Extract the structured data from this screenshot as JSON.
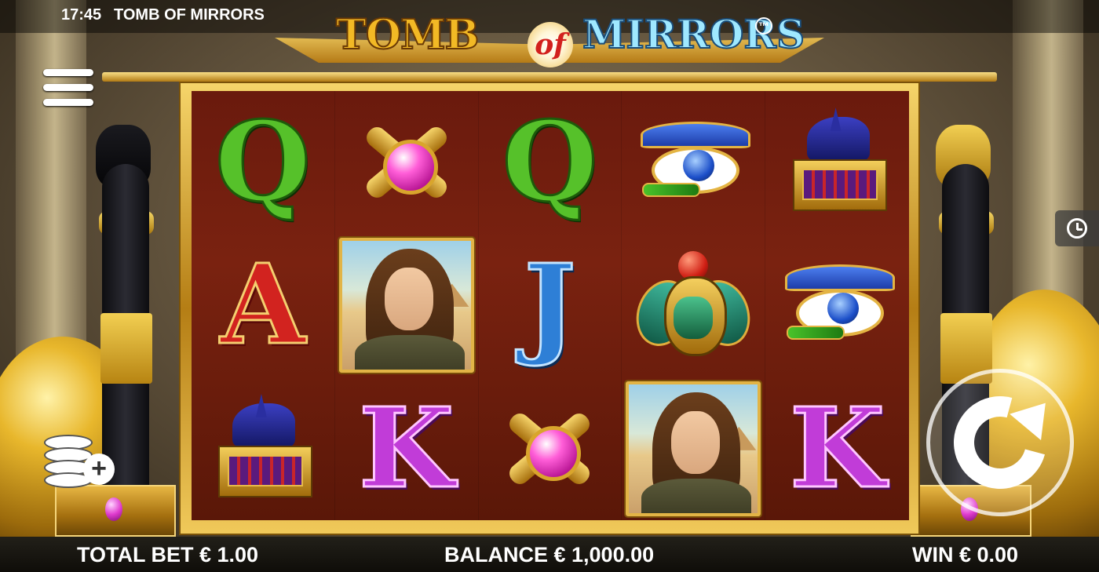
{
  "status": {
    "time": "17:45",
    "game_name": "TOMB OF MIRRORS"
  },
  "logo": {
    "word1": "TOMB",
    "word2": "of",
    "word3": "MIRRORS",
    "trademark": "TM"
  },
  "reels": {
    "symbols": [
      [
        "letter-Q",
        "amulet",
        "letter-Q",
        "eye-of-horus",
        "anubis-chest"
      ],
      [
        "letter-A",
        "explorer-woman",
        "letter-J",
        "scarab",
        "eye-of-horus"
      ],
      [
        "anubis-chest",
        "letter-K",
        "amulet",
        "explorer-woman",
        "letter-K"
      ]
    ],
    "letters": {
      "Q": "Q",
      "A": "A",
      "J": "J",
      "K": "K"
    }
  },
  "controls": {
    "menu_icon": "hamburger-menu-icon",
    "history_icon": "history-clock-icon",
    "coins_icon": "coin-stack-plus-icon",
    "spin_icon": "spin-arrow-icon"
  },
  "footer": {
    "total_bet": "TOTAL BET € 1.00",
    "balance": "BALANCE € 1,000.00",
    "win": "WIN € 0.00"
  },
  "colors": {
    "reel_bg": "#6a1a0d",
    "frame_gold": "#d9a52c",
    "bar_bg": "#15130e"
  }
}
